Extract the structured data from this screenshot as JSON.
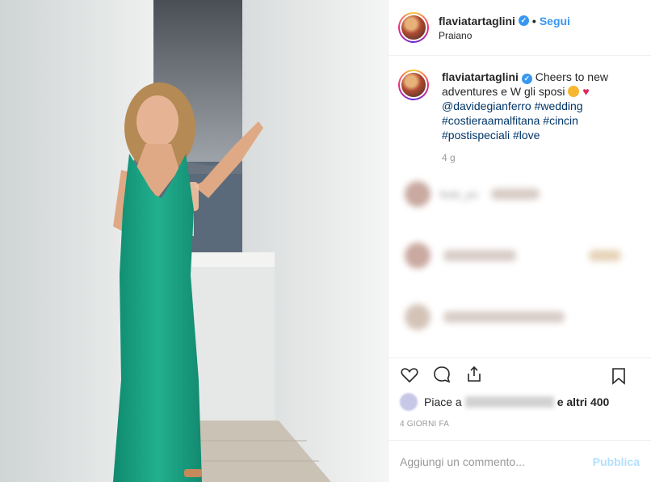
{
  "header": {
    "username": "flaviatartaglini",
    "follow_label": "Segui",
    "separator": "•",
    "location": "Praiano"
  },
  "caption": {
    "username": "flaviatartaglini",
    "text": "Cheers to new adventures e W gli sposi",
    "mention": "@davidegianferro",
    "tags": [
      "#wedding",
      "#costieraamalfitana",
      "#cincin",
      "#postispeciali",
      "#love"
    ],
    "time_ago": "4 g"
  },
  "blurred_comment": {
    "username": "fede_po"
  },
  "likes": {
    "prefix": "Piace a",
    "suffix": "e altri 400"
  },
  "date": "4 GIORNI FA",
  "comment_box": {
    "placeholder": "Aggiungi un commento...",
    "publish_label": "Pubblica"
  },
  "icons": [
    "verified-icon",
    "heart-icon",
    "comment-icon",
    "share-icon",
    "bookmark-icon"
  ]
}
